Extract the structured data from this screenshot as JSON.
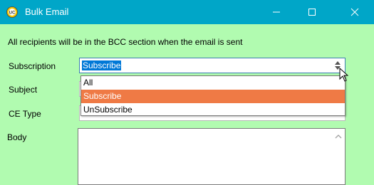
{
  "window": {
    "title": "Bulk Email",
    "icons": {
      "app": "app-logo-icon",
      "minimize": "minimize-icon",
      "maximize": "maximize-icon",
      "close": "close-icon"
    }
  },
  "form": {
    "notice": "All recipients will be in the BCC section when the email is sent",
    "subscription_label": "Subscription",
    "subscription_value": "Subscribe",
    "subscription_options": [
      "All",
      "Subscribe",
      "UnSubscribe"
    ],
    "subscription_selected_index": 1,
    "subject_label": "Subject",
    "ce_type_label": "CE Type",
    "body_label": "Body"
  },
  "colors": {
    "titlebar": "#00a6c8",
    "background": "#b1fbb0",
    "selection": "#0078d7",
    "highlight_option": "#ef7a45"
  }
}
